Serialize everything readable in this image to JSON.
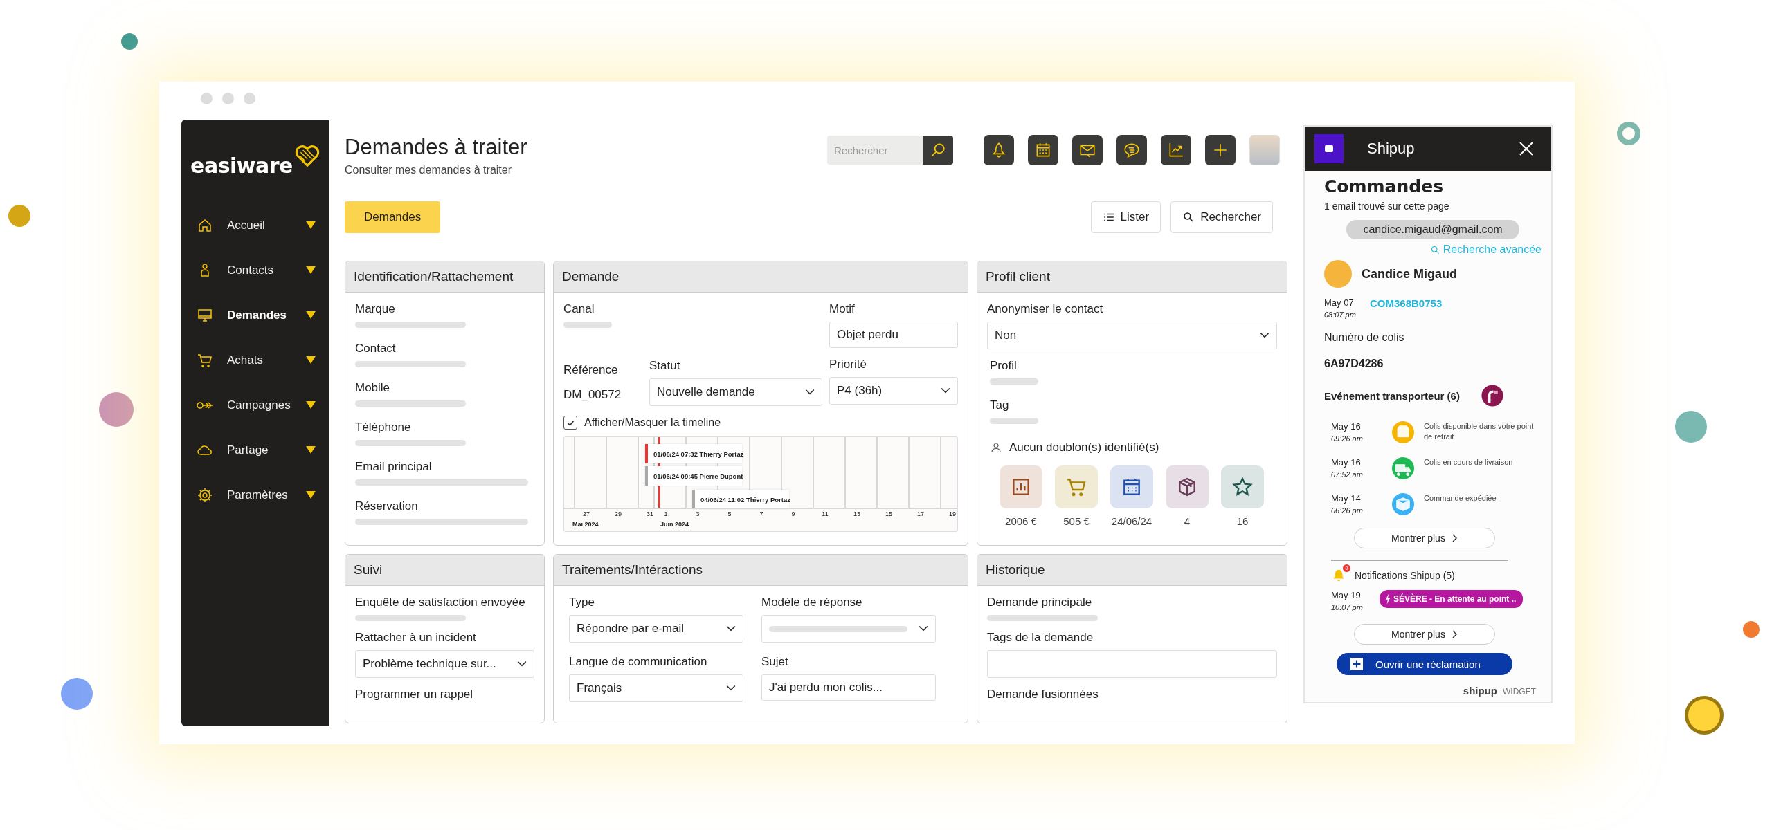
{
  "sidebar": {
    "logo": "easiware",
    "items": [
      {
        "label": "Accueil",
        "selected": false
      },
      {
        "label": "Contacts",
        "selected": false
      },
      {
        "label": "Demandes",
        "selected": true
      },
      {
        "label": "Achats",
        "selected": false
      },
      {
        "label": "Campagnes",
        "selected": false
      },
      {
        "label": "Partage",
        "selected": false
      },
      {
        "label": "Paramètres",
        "selected": false
      }
    ]
  },
  "header": {
    "title": "Demandes à traiter",
    "subtitle": "Consulter mes demandes à traiter",
    "search": {
      "placeholder": "Rechercher"
    }
  },
  "tabs": [
    {
      "label": "Demandes",
      "selected": true
    }
  ],
  "actions": [
    "Lister",
    "Rechercher"
  ],
  "identification": {
    "title": "Identification/Rattachement",
    "fields": [
      "Marque",
      "Contact",
      "Mobile",
      "Téléphone",
      "Email principal",
      "Réservation"
    ]
  },
  "demande": {
    "title": "Demande",
    "canal": "Canal",
    "motif": {
      "label": "Motif",
      "value": "Objet perdu"
    },
    "reference": {
      "label": "Référence",
      "value": "DM_00572"
    },
    "statut": {
      "label": "Statut",
      "value": "Nouvelle demande"
    },
    "priorite": {
      "label": "Priorité",
      "value": "P4 (36h)"
    },
    "timeline_toggle": {
      "label": "Afficher/Masquer la timeline",
      "checked": true
    },
    "timeline": {
      "ticks": [
        "27",
        "29",
        "31",
        "1",
        "3",
        "5",
        "7",
        "9",
        "11",
        "13",
        "15",
        "17",
        "19"
      ],
      "months": [
        "Mai 2024",
        "Juin 2024"
      ],
      "events": [
        {
          "label": "01/06/24 07:32 Thierry Portaz",
          "color": "#e53935"
        },
        {
          "label": "01/06/24 09:45 Pierre Dupont",
          "color": "#a8a8a8"
        },
        {
          "label": "04/06/24 11:02 Thierry Portaz",
          "color": "#a8a8a8"
        }
      ]
    }
  },
  "profil": {
    "title": "Profil client",
    "anonymiser": {
      "label": "Anonymiser le contact",
      "value": "Non"
    },
    "fields": [
      "Profil",
      "Tag"
    ],
    "doublons": "Aucun doublon(s) identifié(s)",
    "stats": [
      {
        "value": "2006 €",
        "color": "#9a4a1f"
      },
      {
        "value": "505 €",
        "color": "#a88400"
      },
      {
        "value": "24/06/24",
        "color": "#1f4fb0"
      },
      {
        "value": "4",
        "color": "#6a3a5a"
      },
      {
        "value": "16",
        "color": "#1f5a50"
      }
    ]
  },
  "suivi": {
    "title": "Suivi",
    "enquete": "Enquête de satisfaction envoyée",
    "incident": {
      "label": "Rattacher à un incident",
      "value": "Problème technique sur..."
    },
    "rappel": "Programmer un rappel"
  },
  "traitements": {
    "title": "Traitements/Intéractions",
    "type": {
      "label": "Type",
      "value": "Répondre par e-mail"
    },
    "modele": {
      "label": "Modèle de réponse"
    },
    "langue": {
      "label": "Langue de communication",
      "value": "Français"
    },
    "sujet": {
      "label": "Sujet",
      "value": "J'ai perdu mon colis..."
    }
  },
  "historique": {
    "title": "Historique",
    "fields": [
      "Demande principale",
      "Tags de la demande",
      "Demande fusionnées"
    ]
  },
  "shipup": {
    "title": "Shipup",
    "heading": "Commandes",
    "found": "1 email trouvé sur cette page",
    "email": "candice.migaud@gmail.com",
    "advanced": "Recherche avancée",
    "customer": "Candice Migaud",
    "order": {
      "date": "May 07",
      "time": "08:07 pm",
      "number": "COM368B0753"
    },
    "parcel_label": "Numéro de colis",
    "parcel": "6A97D4286",
    "events_title": "Evénement transporteur (6)",
    "events": [
      {
        "date": "May 16",
        "time": "09:26 am",
        "text": "Colis disponible dans votre point de retrait",
        "color": "#f5b400"
      },
      {
        "date": "May 16",
        "time": "07:52 am",
        "text": "Colis en cours de livraison",
        "color": "#1db954"
      },
      {
        "date": "May 14",
        "time": "06:26 pm",
        "text": "Commande expédiée",
        "color": "#3ab0f5"
      }
    ],
    "more": "Montrer plus",
    "notif_title": "Notifications Shipup (5)",
    "notif_badge": "0",
    "notifications": [
      {
        "date": "May 19",
        "time": "10:07 pm",
        "text": "SÉVÈRE - En attente au point .."
      }
    ],
    "more2": "Montrer plus",
    "claim": "Ouvrir une réclamation",
    "brand": "shipup",
    "widget": "WIDGET"
  }
}
